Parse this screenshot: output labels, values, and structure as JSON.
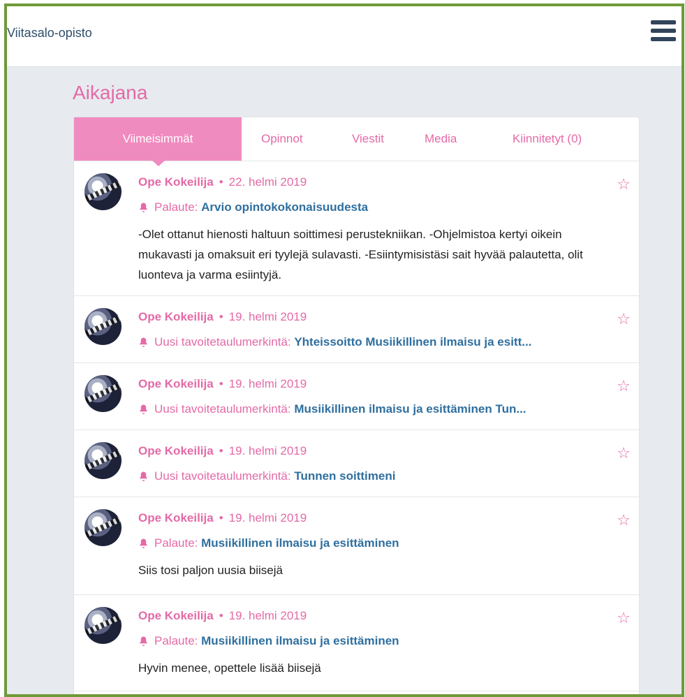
{
  "header": {
    "brand": "Viitasalo-opisto",
    "menu_icon": "hamburger-menu-icon"
  },
  "page": {
    "title": "Aikajana"
  },
  "tabs": [
    {
      "label": "Viimeisimmät",
      "active": true
    },
    {
      "label": "Opinnot",
      "active": false
    },
    {
      "label": "Viestit",
      "active": false
    },
    {
      "label": "Media",
      "active": false
    },
    {
      "label": "Kiinnitetyt (0)",
      "active": false
    }
  ],
  "timeline": [
    {
      "author": "Ope Kokeilija",
      "date": "22. helmi 2019",
      "type": "Palaute:",
      "subject": "Arvio opintokokonaisuudesta",
      "text": "-Olet ottanut hienosti haltuun soittimesi perustekniikan. -Ohjelmistoa kertyi oikein mukavasti ja omaksuit eri tyylejä sulavasti. -Esiintymisistäsi sait hyvää palautetta, olit luonteva ja varma esiintyjä."
    },
    {
      "author": "Ope Kokeilija",
      "date": "19. helmi 2019",
      "type": "Uusi tavoitetaulumerkintä:",
      "subject": "Yhteissoitto Musiikillinen ilmaisu ja esitt...",
      "text": ""
    },
    {
      "author": "Ope Kokeilija",
      "date": "19. helmi 2019",
      "type": "Uusi tavoitetaulumerkintä:",
      "subject": "Musiikillinen ilmaisu ja esittäminen Tun...",
      "text": ""
    },
    {
      "author": "Ope Kokeilija",
      "date": "19. helmi 2019",
      "type": "Uusi tavoitetaulumerkintä:",
      "subject": "Tunnen soittimeni",
      "text": ""
    },
    {
      "author": "Ope Kokeilija",
      "date": "19. helmi 2019",
      "type": "Palaute:",
      "subject": "Musiikillinen ilmaisu ja esittäminen",
      "text": "Siis tosi paljon uusia biisejä"
    },
    {
      "author": "Ope Kokeilija",
      "date": "19. helmi 2019",
      "type": "Palaute:",
      "subject": "Musiikillinen ilmaisu ja esittäminen",
      "text": "Hyvin menee, opettele lisää biisejä"
    }
  ],
  "icons": {
    "star": "star-icon",
    "bell": "bell-icon",
    "avatar": "avatar"
  },
  "colors": {
    "accent": "#e46aa7",
    "link": "#2f6f9f",
    "border": "#6e9a3a"
  }
}
